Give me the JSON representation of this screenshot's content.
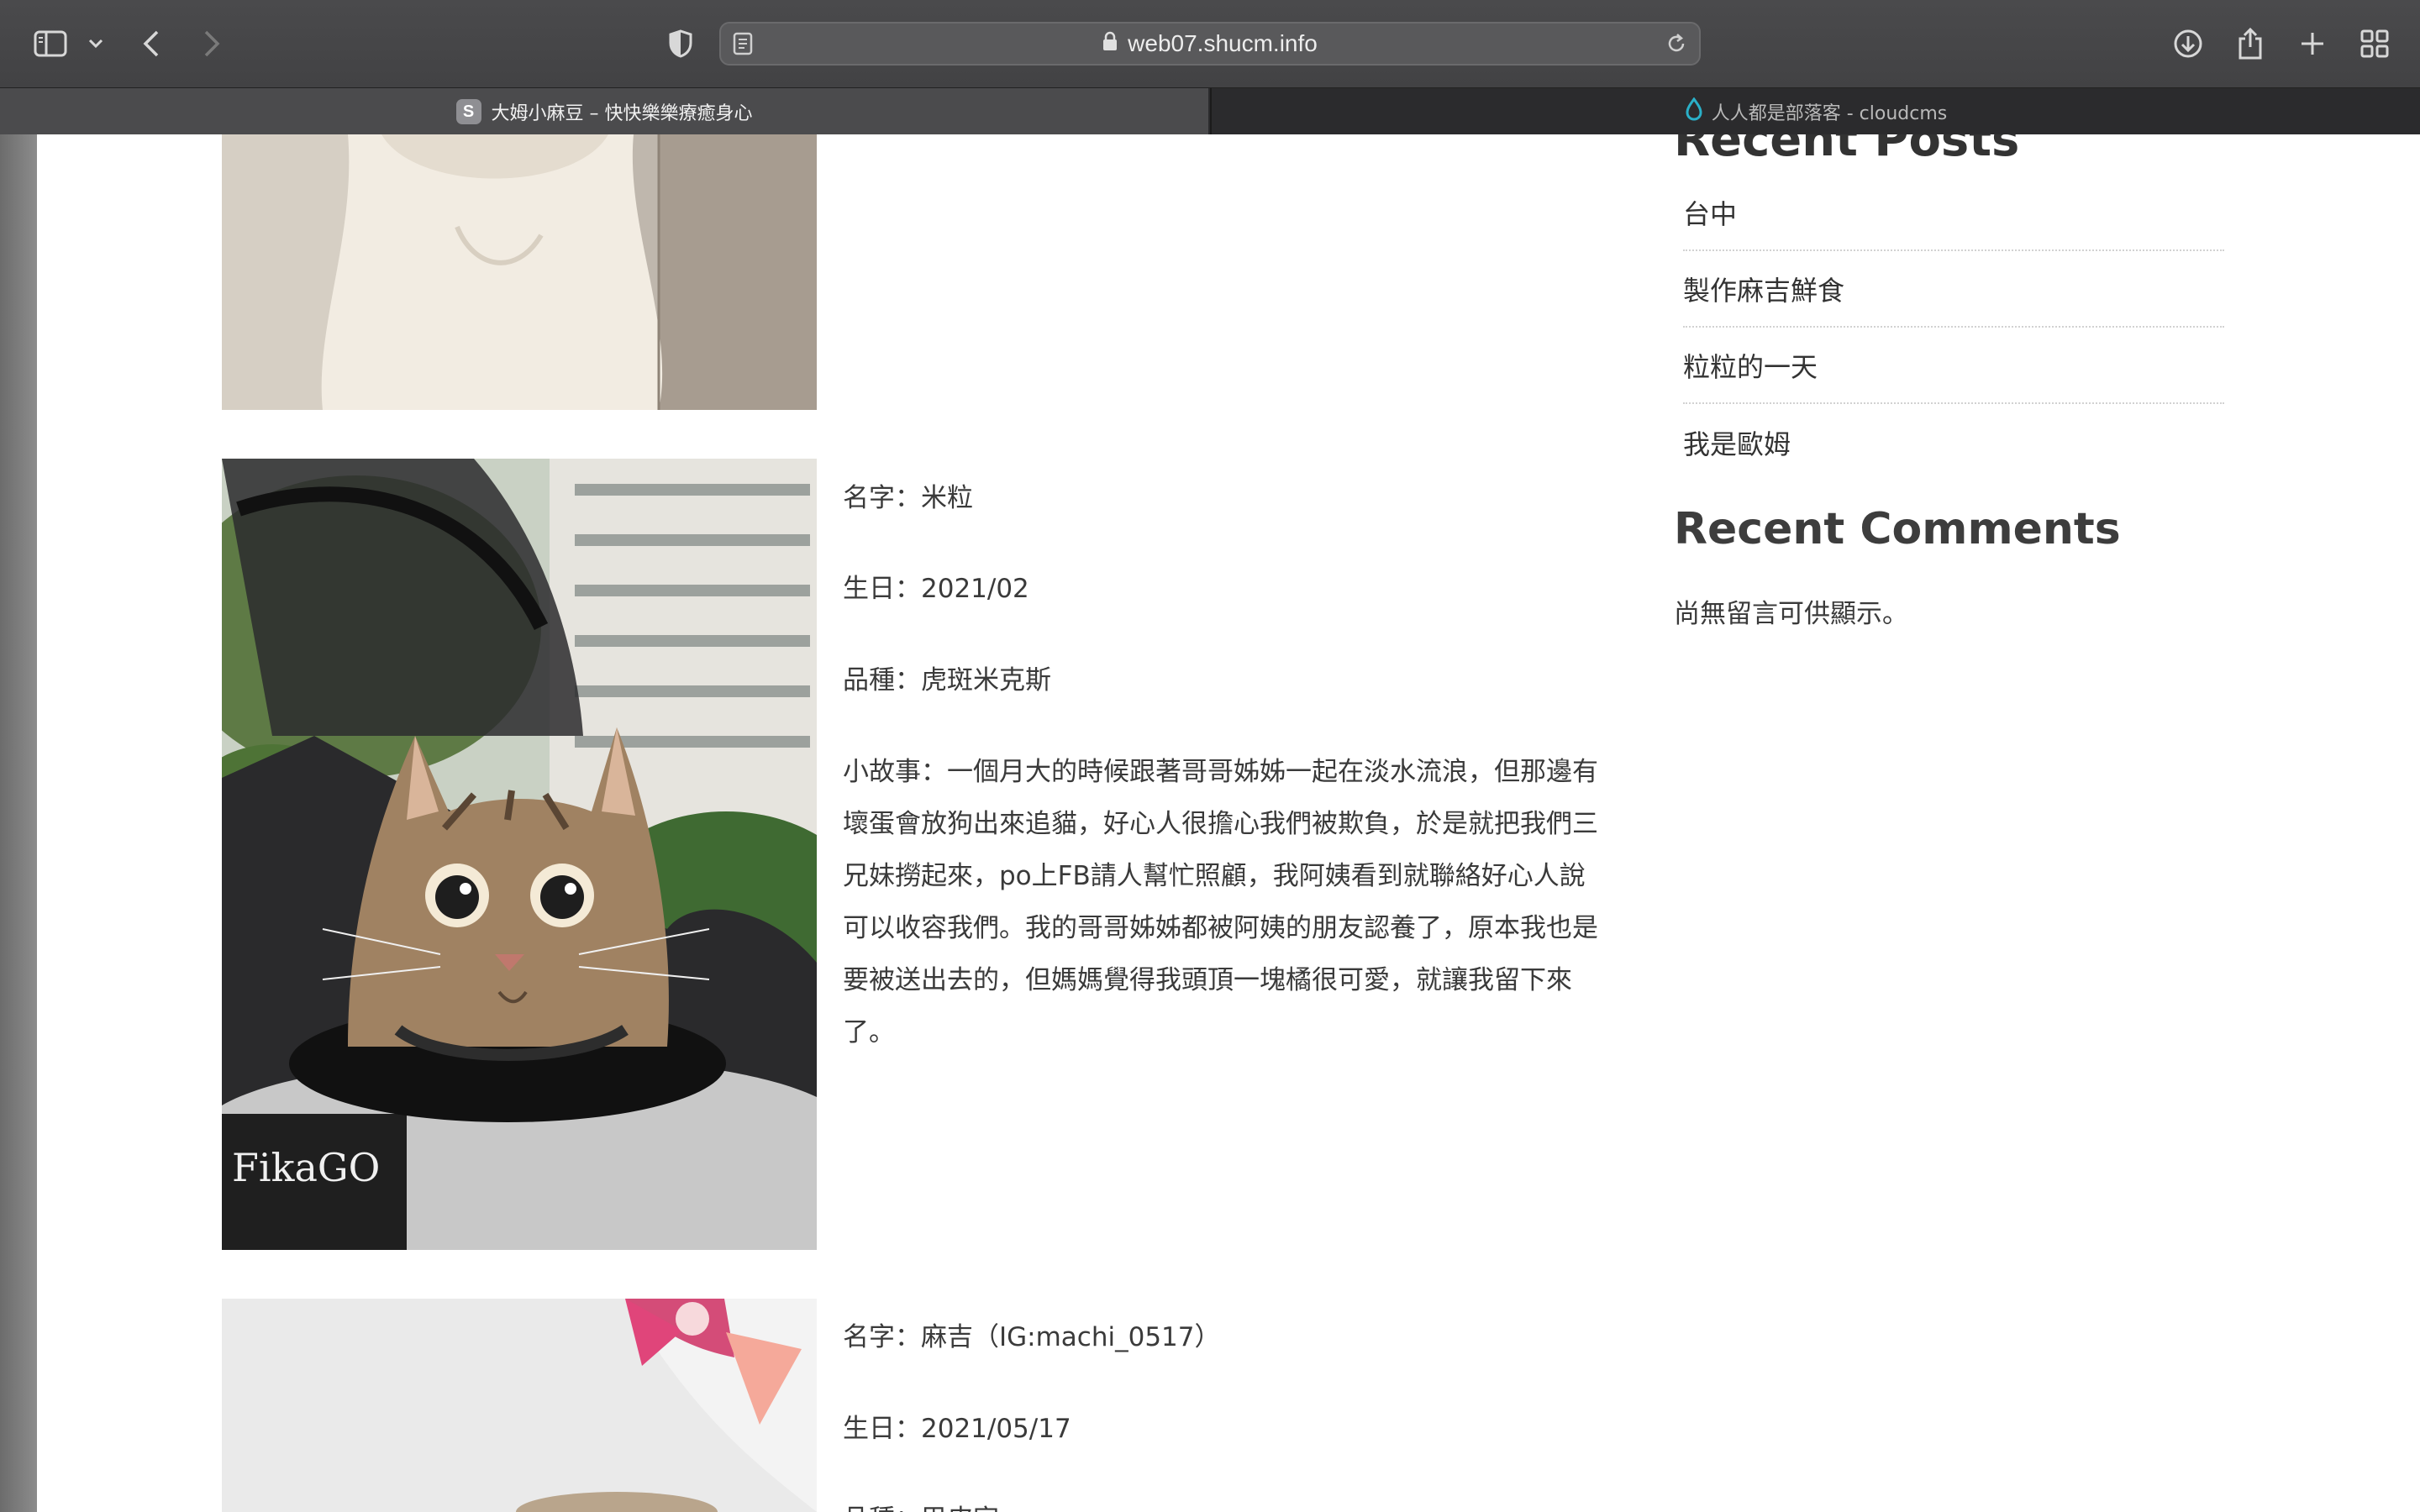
{
  "browser": {
    "url": "web07.shucm.info",
    "tabs": [
      {
        "favicon": "S",
        "title": "大姆小麻豆 – 快快樂樂療癒身心",
        "active": true
      },
      {
        "favicon": "water-drop-icon",
        "title": "人人都是部落客 - cloudcms",
        "active": false
      }
    ],
    "icons": [
      "sidebar-icon",
      "chevron-down-icon",
      "back-icon",
      "forward-icon",
      "shield-icon",
      "reader-icon",
      "lock-icon",
      "reload-icon",
      "download-icon",
      "share-icon",
      "plus-icon",
      "tab-grid-icon"
    ]
  },
  "pets": [
    {
      "name_line": "名字：米粒",
      "birthday_line": "生日：2021/02",
      "breed_line": "品種：虎斑米克斯",
      "story": "小故事：一個月大的時候跟著哥哥姊姊一起在淡水流浪，但那邊有壞蛋會放狗出來追貓，好心人很擔心我們被欺負，於是就把我們三兄妹撈起來，po上FB請人幫忙照顧，我阿姨看到就聯絡好心人說可以收容我們。我的哥哥姊姊都被阿姨的朋友認養了，原本我也是要被送出去的，但媽媽覺得我頭頂一塊橘很可愛，就讓我留下來了。",
      "photo_text": "FikaGO"
    },
    {
      "name_line": "名字：麻吉（IG:machi_0517）",
      "birthday_line": "生日：2021/05/17",
      "breed_line": "品種：巴皮宮"
    }
  ],
  "sidebar": {
    "recent_posts_heading": "Recent Posts",
    "recent_posts": [
      "台中",
      "製作麻吉鮮食",
      "粒粒的一天",
      "我是歐姆"
    ],
    "recent_comments_heading": "Recent Comments",
    "recent_comments_empty": "尚無留言可供顯示。"
  },
  "colors": {
    "toolbar": "#464648",
    "tab_active": "#4b4b4d",
    "page_bg": "#ffffff",
    "text": "#3a3a3a",
    "favicon_drop": "#2ab0c8"
  }
}
